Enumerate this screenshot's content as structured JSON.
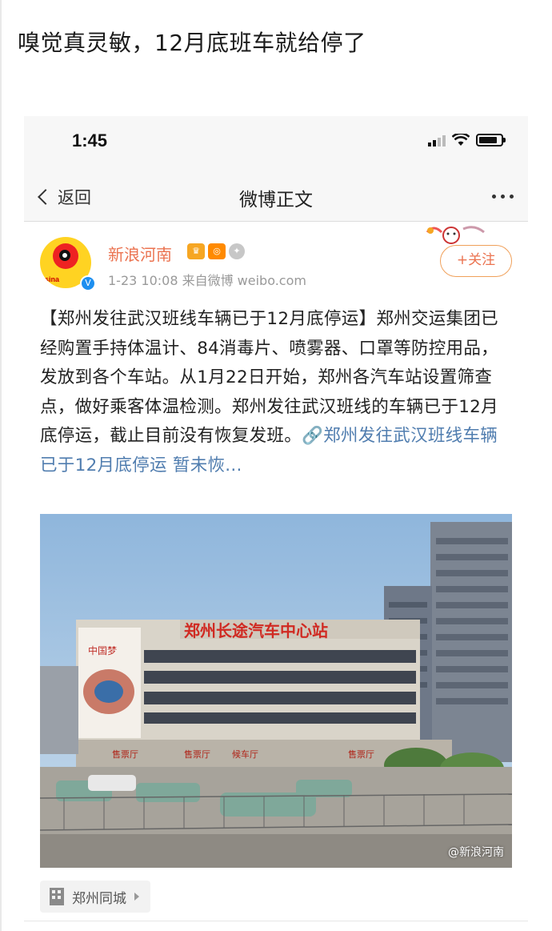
{
  "post": {
    "caption": "嗅觉真灵敏，12月底班车就给停了"
  },
  "status_bar": {
    "time": "1:45"
  },
  "nav": {
    "back_label": "返回",
    "title": "微博正文"
  },
  "weibo": {
    "author": "新浪河南",
    "meta": "1-23 10:08  来自微博 weibo.com",
    "follow_label": "+关注",
    "text_body": "【郑州发往武汉班线车辆已于12月底停运】郑州交运集团已经购置手持体温计、84消毒片、喷雾器、口罩等防控用品，发放到各个车站。从1月22日开始，郑州各汽车站设置筛查点，做好乘客体温检测。郑州发往武汉班线的车辆已于12月底停运，截止目前没有恢复发班。",
    "link_text": "🔗郑州发往武汉班线车辆已于12月底停运 暂未恢...",
    "image_sign": "郑州长途汽车中心站",
    "image_watermark": "@新浪河南",
    "location": "郑州同城"
  },
  "colors": {
    "accent_orange": "#eb7350",
    "link_blue": "#507daf",
    "verified_blue": "#1d8ff0"
  }
}
